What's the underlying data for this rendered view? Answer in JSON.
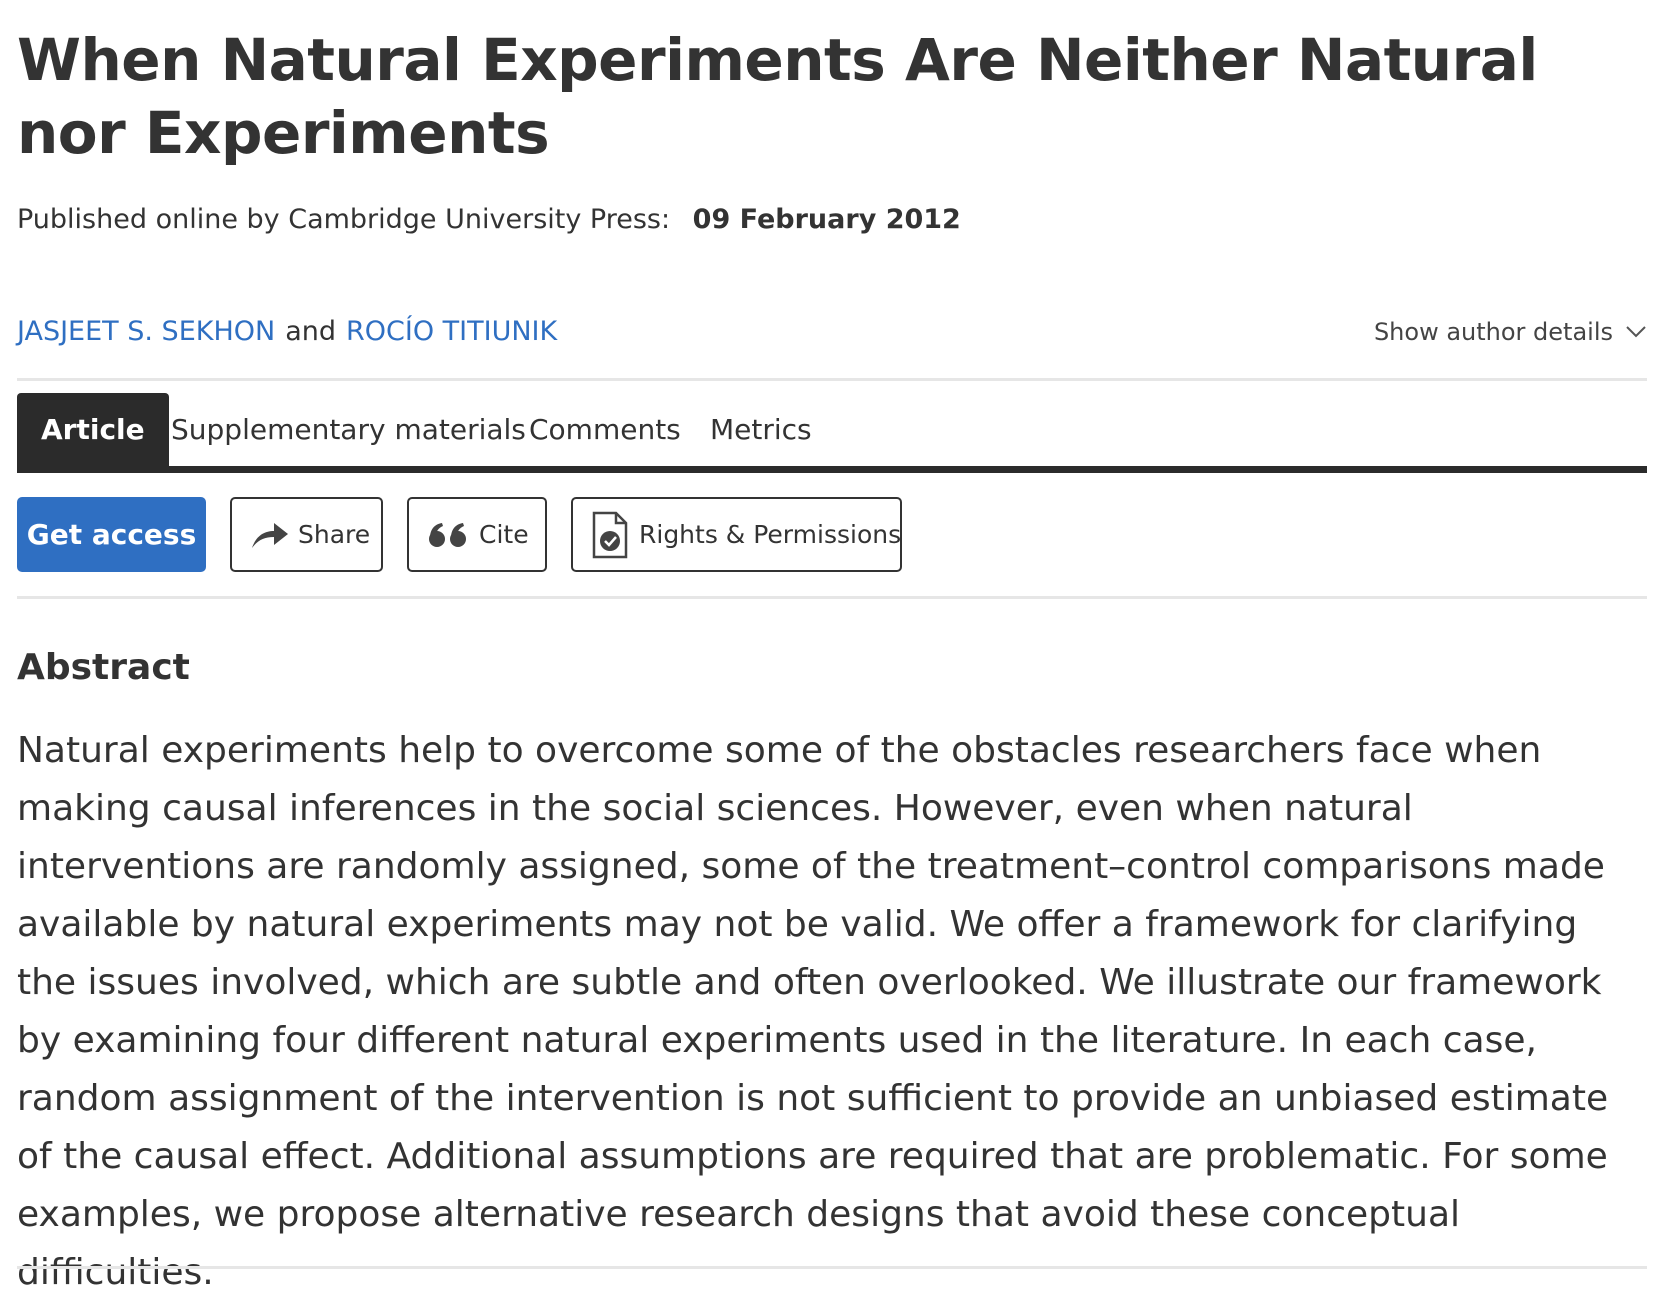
{
  "article": {
    "title": "When Natural Experiments Are Neither Natural nor Experiments",
    "published_label": "Published online by Cambridge University Press:",
    "published_date": "09 February 2012"
  },
  "authors": {
    "first": "JASJEET S. SEKHON",
    "separator": "and",
    "second": "ROCÍO TITIUNIK",
    "details_toggle": "Show author details"
  },
  "tabs": [
    {
      "label": "Article",
      "active": true
    },
    {
      "label": "Supplementary materials",
      "active": false
    },
    {
      "label": "Comments",
      "active": false
    },
    {
      "label": "Metrics",
      "active": false
    }
  ],
  "actions": {
    "get_access": "Get access",
    "share": "Share",
    "cite": "Cite",
    "rights": "Rights & Permissions"
  },
  "abstract": {
    "heading": "Abstract",
    "text": "Natural experiments help to overcome some of the obstacles researchers face when making causal inferences in the social sciences. However, even when natural interventions are randomly assigned, some of the treatment–control comparisons made available by natural experiments may not be valid. We offer a framework for clarifying the issues involved, which are subtle and often overlooked. We illustrate our framework by examining four different natural experiments used in the literature. In each case, random assignment of the intervention is not sufficient to provide an unbiased estimate of the causal effect. Additional assumptions are required that are problematic. For some examples, we propose alternative research designs that avoid these conceptual difficulties."
  },
  "icons": {
    "share": "share-arrow-icon",
    "cite": "quote-icon",
    "rights": "document-check-icon",
    "toggle": "chevron-down-icon"
  },
  "colors": {
    "link": "#2f6fc2",
    "primary_button": "#2f6fc2",
    "active_tab": "#2b2b2b",
    "text": "#333333"
  }
}
